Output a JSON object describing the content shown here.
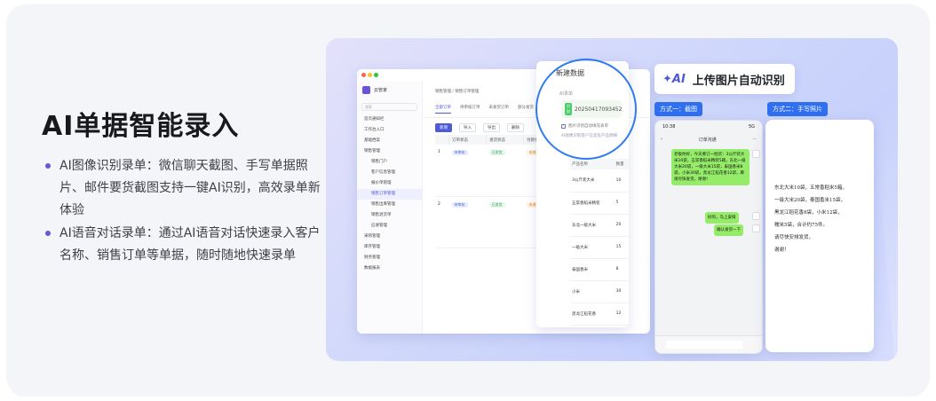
{
  "headline": "AI单据智能录入",
  "bullets": [
    "AI图像识别录单：微信聊天截图、手写单据照片、邮件要货截图支持一键AI识别，高效录单新体验",
    "AI语音对话录单：通过AI语音对话快速录入客户名称、销售订单等单据，随时随地快速录单"
  ],
  "colors": {
    "accent": "#6b55d6",
    "primary_blue": "#2f6ff0"
  },
  "upload_banner": {
    "icon": "ai-sparkle-icon",
    "label": "上传图片自动识别"
  },
  "method_chips": [
    "方式一：截图",
    "方式二：手写照片"
  ],
  "desktop": {
    "brand": "云管家",
    "search_placeholder": "搜索",
    "menu": [
      {
        "label": "首页通知栏",
        "sub": false,
        "active": false
      },
      {
        "label": "工作台入口",
        "sub": false,
        "active": false
      },
      {
        "label": "基础档案",
        "sub": false,
        "active": false
      },
      {
        "label": "销售管理",
        "sub": false,
        "active": false
      },
      {
        "label": "销售门户",
        "sub": true,
        "active": false
      },
      {
        "label": "客户信息管理",
        "sub": true,
        "active": false
      },
      {
        "label": "报价单管理",
        "sub": true,
        "active": false
      },
      {
        "label": "销售订单管理",
        "sub": true,
        "active": true
      },
      {
        "label": "销售出库管理",
        "sub": true,
        "active": false
      },
      {
        "label": "销售退货单",
        "sub": true,
        "active": false
      },
      {
        "label": "应收管理",
        "sub": true,
        "active": false
      },
      {
        "label": "采购管理",
        "sub": false,
        "active": false
      },
      {
        "label": "库存管理",
        "sub": false,
        "active": false
      },
      {
        "label": "财务管理",
        "sub": false,
        "active": false
      },
      {
        "label": "数据报表",
        "sub": false,
        "active": false
      }
    ],
    "breadcrumb": "销售管理 / 销售订单管理",
    "tabs": [
      "全部订单",
      "待审核订单",
      "未发货订单",
      "部分发货"
    ],
    "toolbar": [
      "新增",
      "导入",
      "导出",
      "删除"
    ],
    "table_headers": [
      "",
      "订单状态",
      "发货状态",
      "付款状态",
      "开票"
    ],
    "table_rows": [
      {
        "idx": "1",
        "status": "待审核",
        "ship": "已发货",
        "pay": "未收款"
      },
      {
        "idx": "2",
        "status": "待审核",
        "ship": "已发货",
        "pay": "未收款"
      }
    ]
  },
  "new_data_panel": {
    "title": "新建数据",
    "field_label": "AI录单",
    "ok_badge": "识别",
    "order_no": "20250417093452",
    "checkbox_label": "图片识别自动填充表单",
    "hint": "AI图像识别客户信息及产品明细",
    "product_headers": [
      "产品名称",
      "数量",
      "单价"
    ],
    "products": [
      {
        "name": "3公斤装大米",
        "qty": "10"
      },
      {
        "name": "五常香稻米精装",
        "qty": "5"
      },
      {
        "name": "东北一级大米",
        "qty": "20"
      },
      {
        "name": "一级大米",
        "qty": "15"
      },
      {
        "name": "泰国香米",
        "qty": "8"
      },
      {
        "name": "小米",
        "qty": "30"
      },
      {
        "name": "黑龙江稻花香",
        "qty": "12"
      }
    ]
  },
  "phone": {
    "time": "10:38",
    "signal": "5G",
    "chat_title": "订单沟通",
    "message1": "老板你好，今天要订一批货：3公斤装大米10袋，五常香稻米精装5箱，东北一级大米20袋，一级大米15袋，泰国香米8袋，小米30袋，黑龙江稻花香12袋，麻烦尽快发货，谢谢！",
    "message2": "好的，马上安排",
    "message3": "确认发货一下"
  },
  "paper_lines": [
    "东北大米10袋，五常香稻米5箱，",
    "一级大米20袋，泰国香米15袋，",
    "黑龙江稻花香8袋，小米12袋，",
    "糯米5袋，合计约75件。",
    "请尽快安排发货，",
    "谢谢！"
  ]
}
